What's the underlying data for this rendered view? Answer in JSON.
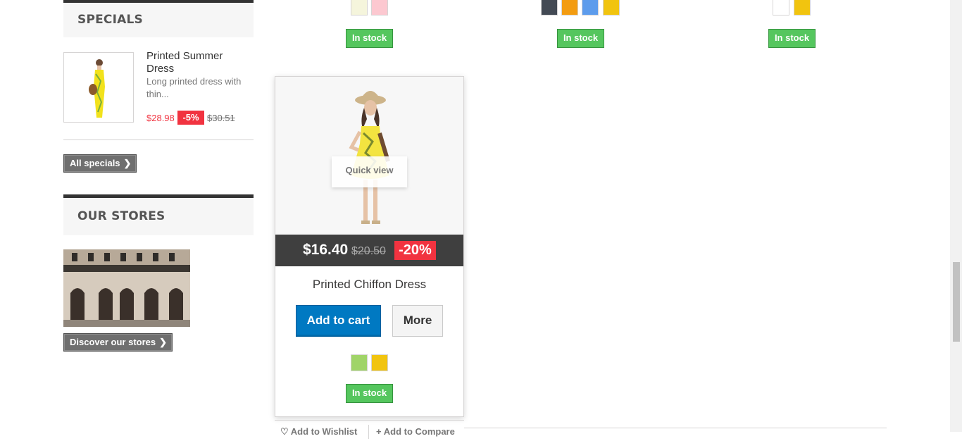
{
  "top_row": {
    "stock_label": "In stock",
    "product1_swatches": [
      "#f5f5dc",
      "#fcc8d0"
    ],
    "product2_swatches": [
      "#434a54",
      "#f39c11",
      "#5d9cec",
      "#f1c40f"
    ],
    "product3_swatches": [
      "#ffffff",
      "#f1c40f"
    ]
  },
  "sidebar": {
    "specials_title": "SPECIALS",
    "special_item": {
      "name": "Printed Summer Dress",
      "description": "Long printed dress with thin...",
      "price": "$28.98",
      "discount": "-5%",
      "old_price": "$30.51"
    },
    "all_specials_label": "All specials",
    "stores_title": "OUR STORES",
    "discover_label": "Discover our stores"
  },
  "product": {
    "quick_view_label": "Quick view",
    "price": "$16.40",
    "old_price": "$20.50",
    "discount": "-20%",
    "name": "Printed Chiffon Dress",
    "add_to_cart_label": "Add to cart",
    "more_label": "More",
    "swatches": [
      "#a0d468",
      "#f1c40f"
    ],
    "stock_label": "In stock",
    "wishlist_label": "Add to Wishlist",
    "compare_label": "Add to Compare"
  },
  "colors": {
    "price_red": "#f13340",
    "stock_green": "#55c65e",
    "cart_blue": "#0079c2"
  }
}
